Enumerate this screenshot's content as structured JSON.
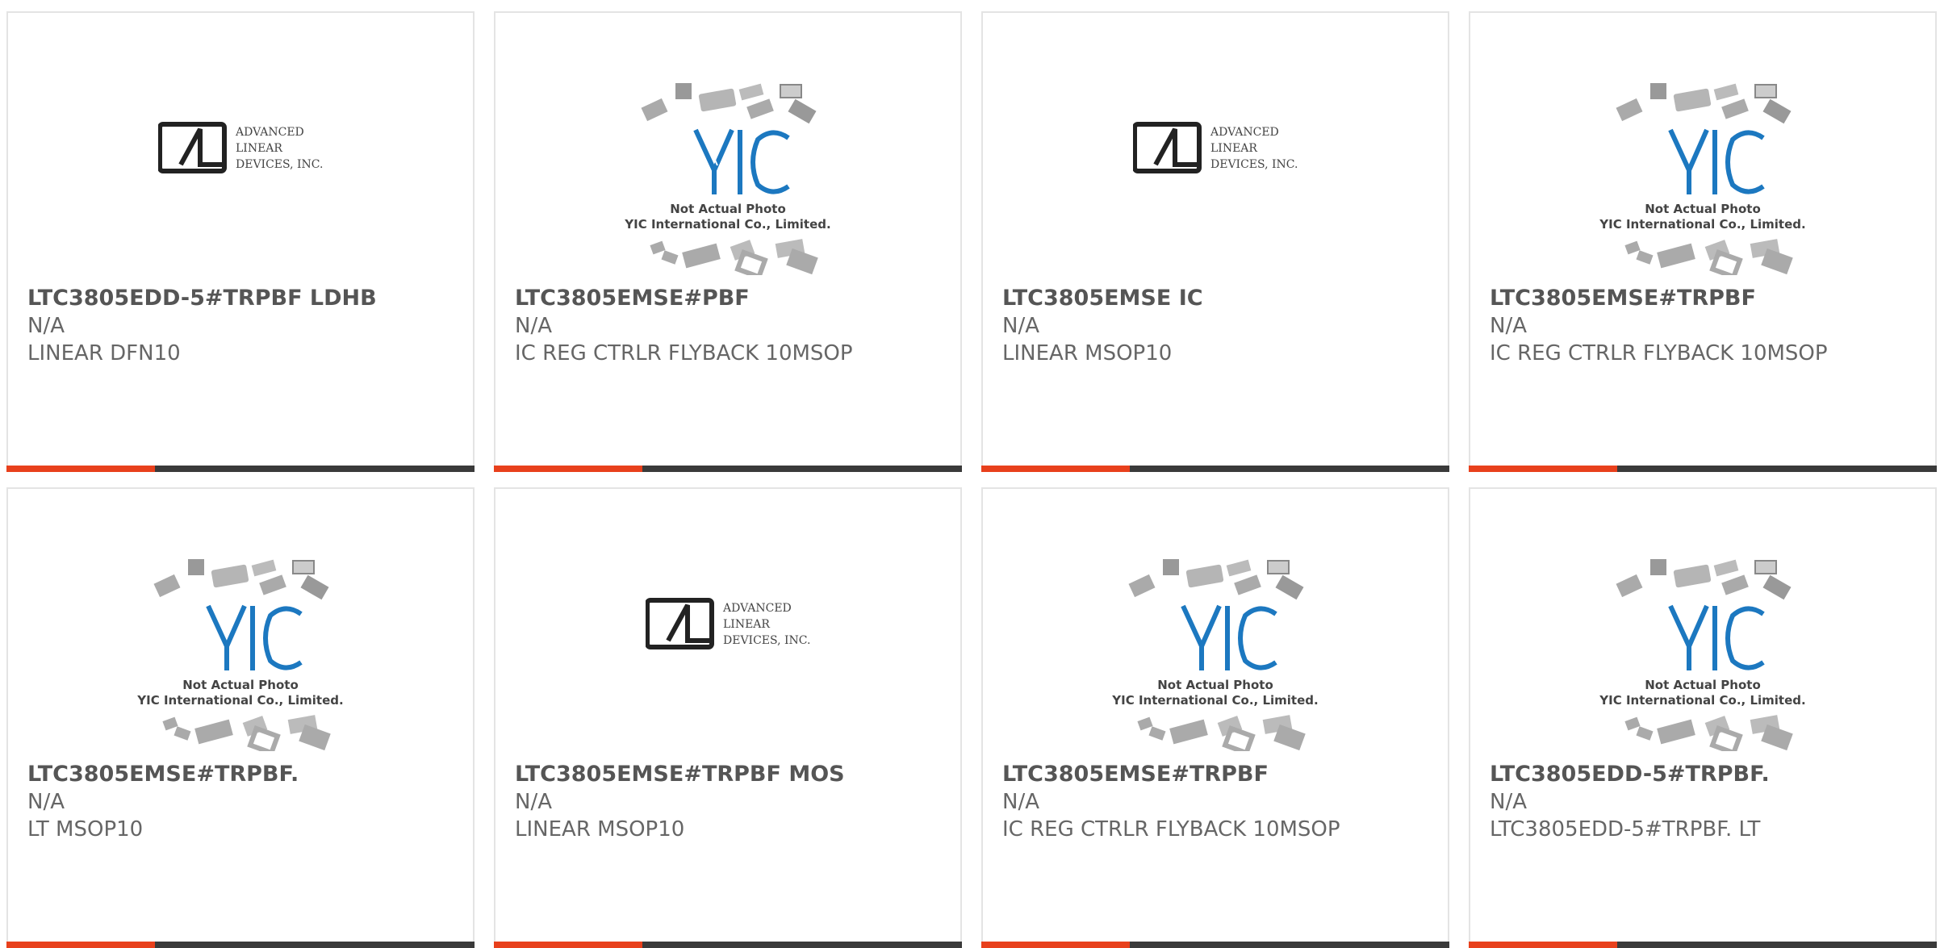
{
  "accent_color": "#e8401c",
  "bar_color": "#3a3a3a",
  "adi_logo": {
    "line1": "ADVANCED",
    "line2": "LINEAR",
    "line3": "DEVICES, INC."
  },
  "yic_logo": {
    "mark": "YIC",
    "line1": "Not Actual Photo",
    "line2": "YIC International Co., Limited."
  },
  "products": [
    {
      "title": "LTC3805EDD-5#TRPBF LDHB",
      "stock": "N/A",
      "desc": "LINEAR DFN10",
      "image": "adi-logo"
    },
    {
      "title": "LTC3805EMSE#PBF",
      "stock": "N/A",
      "desc": "IC REG CTRLR FLYBACK 10MSOP",
      "image": "yic-placeholder"
    },
    {
      "title": "LTC3805EMSE IC",
      "stock": "N/A",
      "desc": "LINEAR MSOP10",
      "image": "adi-logo"
    },
    {
      "title": "LTC3805EMSE#TRPBF",
      "stock": "N/A",
      "desc": "IC REG CTRLR FLYBACK 10MSOP",
      "image": "yic-placeholder"
    },
    {
      "title": "LTC3805EMSE#TRPBF.",
      "stock": "N/A",
      "desc": "LT MSOP10",
      "image": "yic-placeholder"
    },
    {
      "title": "LTC3805EMSE#TRPBF MOS",
      "stock": "N/A",
      "desc": "LINEAR MSOP10",
      "image": "adi-logo"
    },
    {
      "title": "LTC3805EMSE#TRPBF",
      "stock": "N/A",
      "desc": "IC REG CTRLR FLYBACK 10MSOP",
      "image": "yic-placeholder"
    },
    {
      "title": "LTC3805EDD-5#TRPBF.",
      "stock": "N/A",
      "desc": "LTC3805EDD-5#TRPBF. LT",
      "image": "yic-placeholder"
    }
  ]
}
